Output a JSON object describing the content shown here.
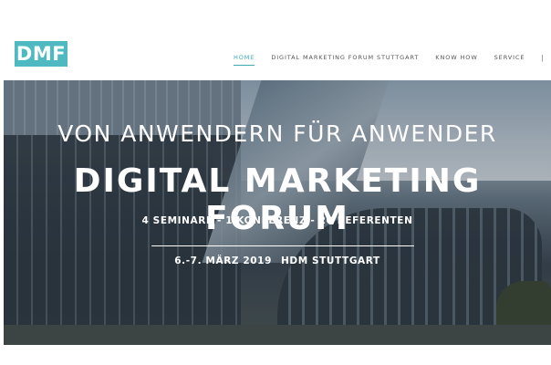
{
  "header": {
    "logo_text": "DMF",
    "nav": [
      {
        "label": "HOME",
        "active": true
      },
      {
        "label": "DIGITAL MARKETING FORUM STUTTGART",
        "active": false
      },
      {
        "label": "KNOW HOW",
        "active": false
      },
      {
        "label": "SERVICE",
        "active": false
      }
    ],
    "separator": "|",
    "search_icon": "search-icon",
    "accent_color": "#3da9b3"
  },
  "hero": {
    "tagline": "VON ANWENDERN FÜR ANWENDER",
    "headline": "DIGITAL MARKETING FORUM",
    "subline": "4 SEMINARE - 1 KONFERENZ - 20 REFERENTEN",
    "date": "6.-7. MÄRZ 2019",
    "venue": "HDM STUTTGART"
  }
}
